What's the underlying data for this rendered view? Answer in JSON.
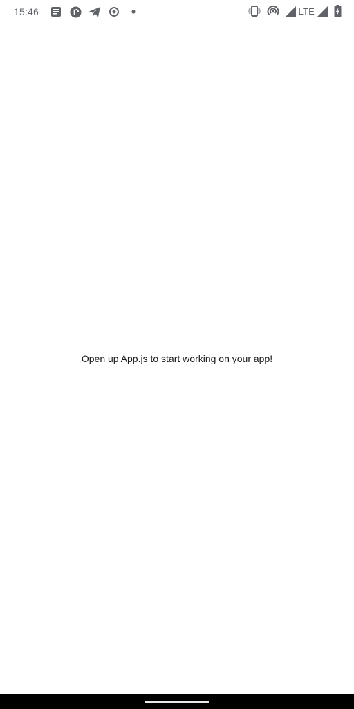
{
  "status_bar": {
    "time": "15:46",
    "network_label": "LTE",
    "notification_icons": [
      "news-icon",
      "pocket-casts-icon",
      "telegram-icon",
      "settings-notification-icon",
      "more-notifications-dot-icon"
    ],
    "system_icons": [
      "vibrate-icon",
      "hotspot-icon",
      "wifi-signal-icon",
      "cell-signal-icon",
      "battery-charging-icon"
    ]
  },
  "main": {
    "message": "Open up App.js to start working on your app!"
  },
  "colors": {
    "background": "#ffffff",
    "status_icons": "#5f6368",
    "text": "#1a1a1a",
    "nav_bar": "#000000",
    "home_handle": "#e8e8e8"
  }
}
